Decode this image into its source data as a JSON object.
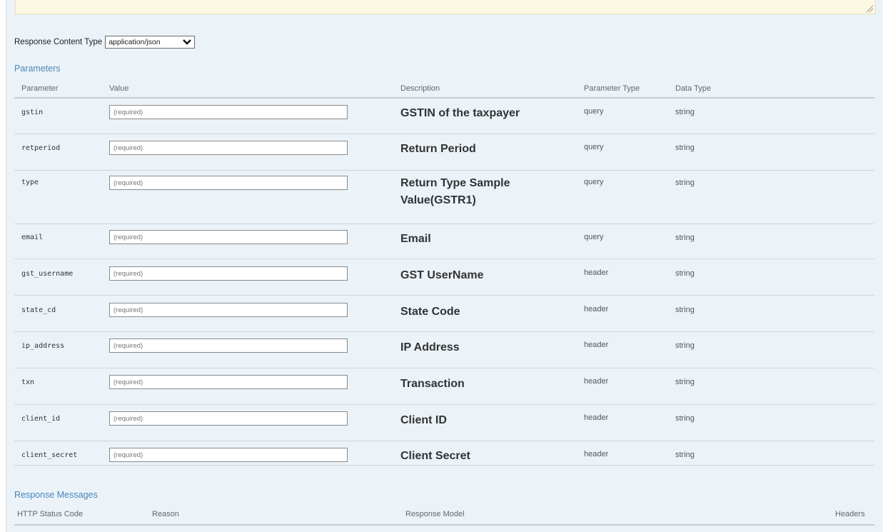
{
  "response_content_type": {
    "label": "Response Content Type",
    "selected": "application/json"
  },
  "parameters": {
    "title": "Parameters",
    "columns": {
      "parameter": "Parameter",
      "value": "Value",
      "description": "Description",
      "parameter_type": "Parameter Type",
      "data_type": "Data Type"
    },
    "rows": [
      {
        "name": "gstin",
        "placeholder": "(required)",
        "description": "GSTIN of the taxpayer",
        "param_type": "query",
        "data_type": "string"
      },
      {
        "name": "retperiod",
        "placeholder": "(required)",
        "description": "Return Period",
        "param_type": "query",
        "data_type": "string"
      },
      {
        "name": "type",
        "placeholder": "(required)",
        "description": "Return Type Sample Value(GSTR1)",
        "param_type": "query",
        "data_type": "string"
      },
      {
        "name": "email",
        "placeholder": "(required)",
        "description": "Email",
        "param_type": "query",
        "data_type": "string"
      },
      {
        "name": "gst_username",
        "placeholder": "(required)",
        "description": "GST UserName",
        "param_type": "header",
        "data_type": "string"
      },
      {
        "name": "state_cd",
        "placeholder": "(required)",
        "description": "State Code",
        "param_type": "header",
        "data_type": "string"
      },
      {
        "name": "ip_address",
        "placeholder": "(required)",
        "description": "IP Address",
        "param_type": "header",
        "data_type": "string"
      },
      {
        "name": "txn",
        "placeholder": "(required)",
        "description": "Transaction",
        "param_type": "header",
        "data_type": "string"
      },
      {
        "name": "client_id",
        "placeholder": "(required)",
        "description": "Client ID",
        "param_type": "header",
        "data_type": "string"
      },
      {
        "name": "client_secret",
        "placeholder": "(required)",
        "description": "Client Secret",
        "param_type": "header",
        "data_type": "string"
      }
    ]
  },
  "response_messages": {
    "title": "Response Messages",
    "columns": {
      "status_code": "HTTP Status Code",
      "reason": "Reason",
      "response_model": "Response Model",
      "headers": "Headers"
    }
  },
  "colors": {
    "panel_bg": "#ebf3f9",
    "section_title": "#4a86b8",
    "textarea_bg": "#fdf8e1"
  }
}
